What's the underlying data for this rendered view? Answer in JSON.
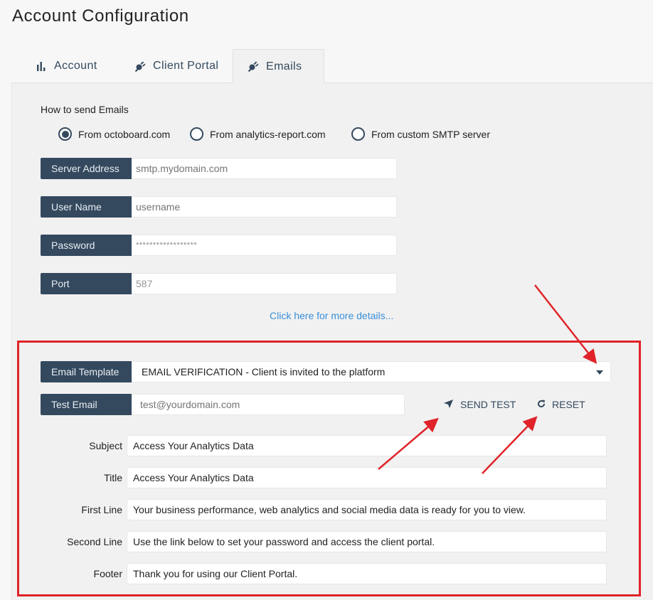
{
  "page": {
    "title": "Account Configuration"
  },
  "tabs": [
    {
      "label": "Account",
      "icon": "bar-chart-icon",
      "active": false
    },
    {
      "label": "Client Portal",
      "icon": "plug-icon",
      "active": false
    },
    {
      "label": "Emails",
      "icon": "plug-icon",
      "active": true
    }
  ],
  "send_method": {
    "label": "How to send Emails",
    "options": [
      {
        "label": "From octoboard.com",
        "selected": true
      },
      {
        "label": "From analytics-report.com",
        "selected": false
      },
      {
        "label": "From custom SMTP server",
        "selected": false
      }
    ]
  },
  "smtp": {
    "server_address": {
      "label": "Server Address",
      "placeholder": "smtp.mydomain.com",
      "value": ""
    },
    "user_name": {
      "label": "User Name",
      "placeholder": "username",
      "value": ""
    },
    "password": {
      "label": "Password",
      "value": "******************"
    },
    "port": {
      "label": "Port",
      "value": "587"
    },
    "details_link": "Click here for more details..."
  },
  "template": {
    "email_template": {
      "label": "Email Template",
      "selected": "EMAIL VERIFICATION - Client is invited to the platform"
    },
    "test_email": {
      "label": "Test Email",
      "placeholder": "test@yourdomain.com",
      "value": ""
    },
    "send_test_label": "SEND TEST",
    "reset_label": "RESET",
    "fields": [
      {
        "label": "Subject",
        "value": "Access Your Analytics Data"
      },
      {
        "label": "Title",
        "value": "Access Your Analytics Data"
      },
      {
        "label": "First Line",
        "value": "Your business performance, web analytics and social media data is ready for you to view."
      },
      {
        "label": "Second Line",
        "value": "Use the link below to set your password and access the client portal."
      },
      {
        "label": "Footer",
        "value": "Thank you for using our Client Portal."
      }
    ]
  },
  "colors": {
    "label_bg": "#34495e",
    "accent_link": "#3a8fd8",
    "annotation_red": "#e02329"
  }
}
